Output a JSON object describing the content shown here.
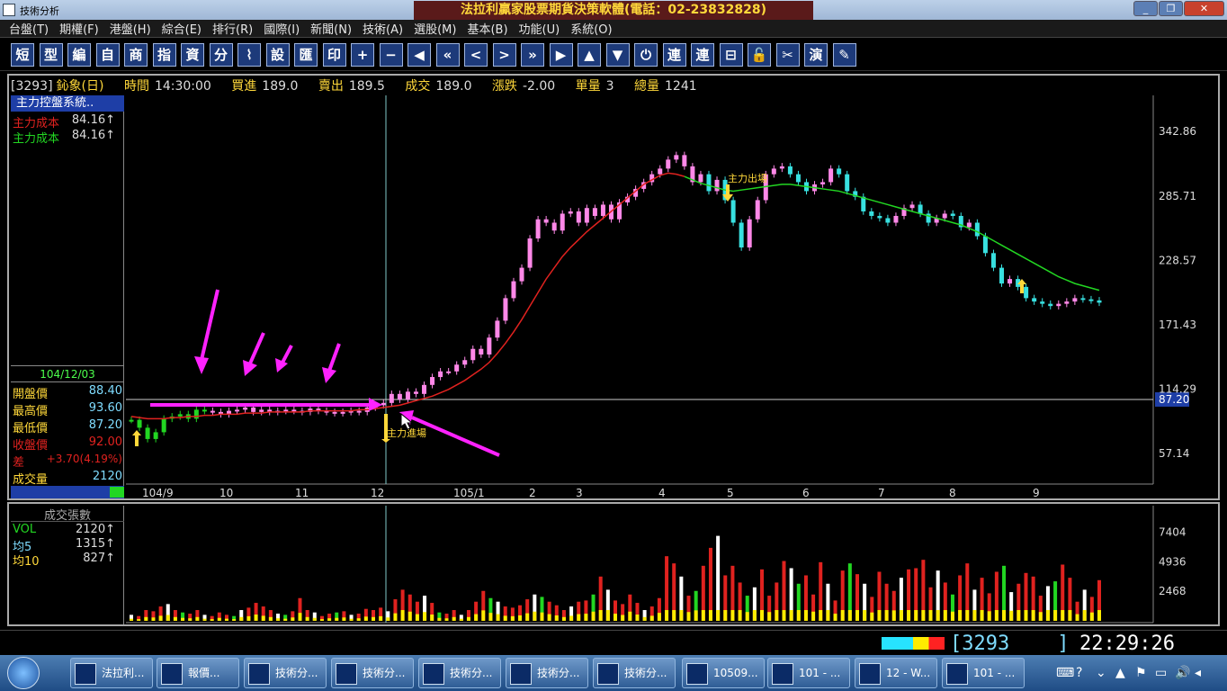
{
  "window": {
    "app_title": "技術分析",
    "main_title": "法拉利贏家股票期貨決策軟體(電話：02-23832828)",
    "controls": [
      "_",
      "❐",
      "✕"
    ]
  },
  "menu": [
    "台盤(T)",
    "期權(F)",
    "港盤(H)",
    "綜合(E)",
    "排行(R)",
    "國際(I)",
    "新聞(N)",
    "技術(A)",
    "選股(M)",
    "基本(B)",
    "功能(U)",
    "系統(O)"
  ],
  "toolbar": [
    "短",
    "型",
    "編",
    "自",
    "商",
    "指",
    "資",
    "分",
    "⌇",
    "設",
    "匯",
    "印",
    "+",
    "−",
    "◀",
    "«",
    "<",
    ">",
    "»",
    "▶",
    "▲",
    "▼",
    "⏻",
    "連",
    "連",
    "⊟",
    "🔓",
    "✂",
    "演",
    "✎"
  ],
  "quote": {
    "code": "[3293]",
    "name": "鈊象(日)",
    "time_label": "時間",
    "time": "14:30:00",
    "bid_label": "買進",
    "bid": "189.0",
    "ask_label": "賣出",
    "ask": "189.5",
    "deal_label": "成交",
    "deal": "189.0",
    "change_label": "漲跌",
    "change": "-2.00",
    "unit_label": "單量",
    "unit": "3",
    "total_label": "總量",
    "total": "1241"
  },
  "indicator": {
    "title": "主力控盤系統..",
    "rows": [
      {
        "label": "主力成本",
        "value": "84.16↑",
        "color": "#e0221f"
      },
      {
        "label": "主力成本",
        "value": "84.16↑",
        "color": "#22d622"
      }
    ]
  },
  "day": {
    "date": "104/12/03",
    "rows": [
      {
        "label": "開盤價",
        "value": "88.40"
      },
      {
        "label": "最高價",
        "value": "93.60"
      },
      {
        "label": "最低價",
        "value": "87.20"
      },
      {
        "label": "收盤價",
        "value": "92.00"
      },
      {
        "label": "差",
        "value": "+3.70(4.19%)"
      },
      {
        "label": "成交量",
        "value": "2120"
      }
    ]
  },
  "volume_panel": {
    "title": "成交張數",
    "rows": [
      {
        "label": "VOL",
        "value": "2120↑"
      },
      {
        "label": "均5",
        "value": "1315↑"
      },
      {
        "label": "均10",
        "value": "827↑"
      }
    ]
  },
  "annotations": {
    "exit": "主力出場",
    "enter": "主力進場"
  },
  "crosshair_price": "87.20",
  "status": {
    "code": "3293",
    "clock": "22:29:26"
  },
  "taskbar": {
    "start": "start",
    "items": [
      "法拉利...",
      "報價...",
      "技術分...",
      "技術分...",
      "技術分...",
      "技術分...",
      "技術分...",
      "10509...",
      "101 - ...",
      "12 - W...",
      "101 - ..."
    ],
    "tray": [
      "⌨",
      "?",
      "⌄",
      "▲",
      "⚑",
      "▭",
      "🔊",
      "◂"
    ]
  },
  "chart_data": [
    {
      "type": "line",
      "title": "",
      "xlabel": "",
      "ylabel": "",
      "x_ticks": [
        "104/9",
        "10",
        "11",
        "12",
        "105/1",
        "2",
        "3",
        "4",
        "5",
        "6",
        "7",
        "8",
        "9"
      ],
      "y_ticks": [
        57.14,
        114.29,
        171.43,
        228.57,
        285.71,
        342.86
      ],
      "ylim": [
        30,
        375
      ],
      "series": [
        {
          "name": "",
          "color": "#ff88e8",
          "values": [
            87,
            80,
            70,
            76,
            88,
            90,
            92,
            88,
            96,
            95,
            94,
            92,
            95,
            96,
            98,
            94,
            96,
            94,
            95,
            96,
            95,
            94,
            97,
            95,
            94,
            93,
            94,
            95,
            94,
            98,
            100,
            102,
            110,
            105,
            112,
            110,
            118,
            125,
            130,
            130,
            136,
            140,
            150,
            145,
            160,
            175,
            195,
            210,
            222,
            248,
            265,
            262,
            255,
            270,
            272,
            262,
            275,
            268,
            278,
            265,
            280,
            285,
            292,
            298,
            305,
            310,
            318,
            322,
            312,
            298,
            305,
            290,
            300,
            282,
            262,
            240,
            265,
            282,
            305,
            310,
            312,
            305,
            298,
            290,
            296,
            298,
            310,
            305,
            290,
            285,
            272,
            268,
            266,
            262,
            268,
            275,
            278,
            270,
            262,
            266,
            270,
            268,
            258,
            262,
            250,
            235,
            222,
            208,
            212,
            205,
            195,
            192,
            190,
            188,
            190,
            192,
            195,
            194,
            193,
            191
          ]
        },
        {
          "name": "",
          "color": "#e0221f",
          "values": [
            90,
            89,
            88,
            88,
            88,
            89,
            89,
            90,
            90,
            91,
            91,
            92,
            92,
            92,
            93,
            93,
            93,
            94,
            94,
            94,
            94,
            94,
            95,
            95,
            95,
            95,
            95,
            95,
            96,
            96,
            97,
            98,
            99,
            100,
            102,
            104,
            106,
            108,
            111,
            114,
            118,
            122,
            127,
            132,
            138,
            146,
            155,
            165,
            176,
            188,
            200,
            212,
            222,
            232,
            240,
            247,
            254,
            260,
            266,
            272,
            278,
            284,
            290,
            296,
            300,
            304,
            306,
            305,
            303,
            300,
            297,
            295,
            293,
            291,
            290,
            291,
            292,
            293,
            294,
            295,
            296,
            296,
            295,
            294,
            293,
            292,
            291,
            290,
            288,
            286,
            284,
            282,
            280,
            278,
            276,
            274,
            272,
            270,
            268,
            266,
            264,
            262,
            260,
            257,
            254,
            250,
            246,
            242,
            238,
            234,
            230,
            226,
            222,
            218,
            214,
            211,
            208,
            206,
            204,
            202
          ]
        }
      ]
    },
    {
      "type": "bar",
      "title": "",
      "xlabel": "",
      "ylabel": "",
      "y_ticks": [
        2468,
        4936,
        7404
      ],
      "ylim": [
        0,
        9400
      ],
      "series": [
        {
          "name": "VOL",
          "values": [
            500,
            400,
            900,
            800,
            1200,
            1400,
            900,
            700,
            600,
            900,
            500,
            400,
            700,
            500,
            400,
            900,
            1100,
            1500,
            1200,
            900,
            600,
            500,
            800,
            1900,
            900,
            700,
            400,
            600,
            700,
            800,
            500,
            600,
            1000,
            900,
            1100,
            800,
            1800,
            2600,
            2200,
            1600,
            2100,
            1500,
            700,
            600,
            900,
            500,
            900,
            1600,
            2500,
            1900,
            1600,
            1200,
            1100,
            1300,
            1800,
            2200,
            2000,
            1600,
            1300,
            900,
            1200,
            1600,
            1700,
            2200,
            3700,
            2600,
            1700,
            1400,
            2200,
            1500,
            900,
            1200,
            1900,
            5400,
            4800,
            3700,
            2100,
            2500,
            4600,
            6100,
            7100,
            3800,
            4600,
            3200,
            2100,
            2800,
            4300,
            2100,
            3200,
            5000,
            4400,
            3100,
            3800,
            2200,
            4900,
            3100,
            1700,
            4200,
            4800,
            3900,
            3100,
            2000,
            4100,
            3100,
            2500,
            3600,
            4300,
            4400,
            5100,
            2800,
            4200,
            3200,
            2200,
            3800,
            4800,
            2600,
            3600,
            2300,
            4100,
            4600,
            2400,
            3100,
            4000,
            3700,
            2100,
            2900,
            3300,
            4700,
            3600,
            1600,
            2600,
            2000,
            3400
          ]
        }
      ]
    }
  ]
}
